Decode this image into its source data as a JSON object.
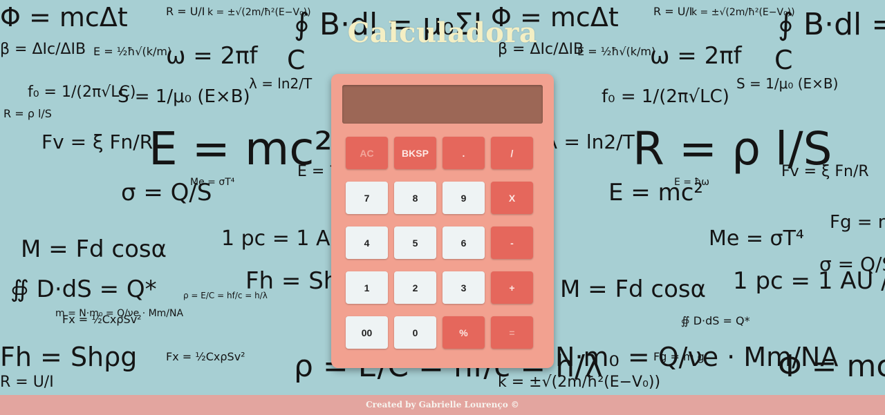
{
  "title": "Calculadora",
  "display": {
    "value": ""
  },
  "keys": [
    {
      "label": "AC",
      "kind": "op",
      "dim": true
    },
    {
      "label": "BKSP",
      "kind": "op"
    },
    {
      "label": ".",
      "kind": "op"
    },
    {
      "label": "/",
      "kind": "op"
    },
    {
      "label": "7",
      "kind": "num"
    },
    {
      "label": "8",
      "kind": "num"
    },
    {
      "label": "9",
      "kind": "num"
    },
    {
      "label": "X",
      "kind": "op"
    },
    {
      "label": "4",
      "kind": "num"
    },
    {
      "label": "5",
      "kind": "num"
    },
    {
      "label": "6",
      "kind": "num"
    },
    {
      "label": "-",
      "kind": "op"
    },
    {
      "label": "1",
      "kind": "num"
    },
    {
      "label": "2",
      "kind": "num"
    },
    {
      "label": "3",
      "kind": "num"
    },
    {
      "label": "+",
      "kind": "op"
    },
    {
      "label": "00",
      "kind": "num"
    },
    {
      "label": "0",
      "kind": "num"
    },
    {
      "label": "%",
      "kind": "op"
    },
    {
      "label": "=",
      "kind": "op",
      "dim": true
    }
  ],
  "footer": {
    "text": "Created by Gabrielle Lourenço ©"
  },
  "background": {
    "formulas": [
      "Φ = mcΔt",
      "R = U/I",
      "k = ±√(2m/ħ²(E−V₀))",
      "∮ B·dl = μ₀ΣI",
      "β = ΔIc/ΔIB",
      "E = ½ħ√(k/m)",
      "ω = 2πf",
      "C",
      "f₀ = 1/(2π√LC)",
      "S = 1/μ₀ (E×B)",
      "λ = ln2/T",
      "R = ρ l/S",
      "Fv = ξ Fn/R",
      "E = mc²",
      "E = ħω",
      "σ = Q/S",
      "Me = σT⁴",
      "M = Fd cosα",
      "1 pc = 1 AU / r",
      "∯ D·dS = Q*",
      "Fh = Shρg",
      "Fx = ½CxρSv²",
      "ρ = E/C = hf/c = h/λ",
      "m = N·m₀ = Q/νe · Mm/NA",
      "Fg = m g"
    ]
  },
  "colors": {
    "background": "#a7cfd3",
    "calculator_body": "#f2a190",
    "display": "#9c6756",
    "operator_key": "#e5675c",
    "number_key": "#eef3f4",
    "title": "#f4efc4",
    "footer": "#e3a59f"
  }
}
